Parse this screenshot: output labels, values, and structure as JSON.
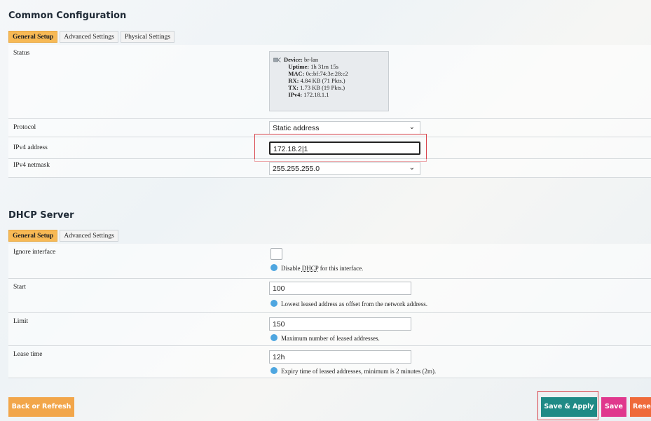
{
  "common": {
    "title": "Common Configuration",
    "tabs": [
      "General Setup",
      "Advanced Settings",
      "Physical Settings"
    ],
    "status": {
      "label": "Status",
      "device_label": "Device:",
      "device": "br-lan",
      "uptime_label": "Uptime:",
      "uptime": "1h 31m 15s",
      "mac_label": "MAC:",
      "mac": "0c:bf:74:3e:28:c2",
      "rx_label": "RX:",
      "rx": "4.84 KB (71 Pkts.)",
      "tx_label": "TX:",
      "tx": "1.73 KB (19 Pkts.)",
      "ipv4_label": "IPv4:",
      "ipv4": "172.18.1.1"
    },
    "protocol": {
      "label": "Protocol",
      "value": "Static address"
    },
    "ipv4_address": {
      "label": "IPv4 address",
      "value": "172.18.2|1"
    },
    "ipv4_netmask": {
      "label": "IPv4 netmask",
      "value": "255.255.255.0"
    }
  },
  "dhcp": {
    "title": "DHCP Server",
    "tabs": [
      "General Setup",
      "Advanced Settings"
    ],
    "ignore": {
      "label": "Ignore interface",
      "hint_pre": "Disable ",
      "hint_abbr": "DHCP",
      "hint_post": " for this interface."
    },
    "start": {
      "label": "Start",
      "value": "100",
      "hint": "Lowest leased address as offset from the network address."
    },
    "limit": {
      "label": "Limit",
      "value": "150",
      "hint": "Maximum number of leased addresses."
    },
    "lease": {
      "label": "Lease time",
      "value": "12h",
      "hint": "Expiry time of leased addresses, minimum is 2 minutes (2m)."
    }
  },
  "footer": {
    "back": "Back or Refresh",
    "save_apply": "Save & Apply",
    "save": "Save",
    "reset": "Rese"
  },
  "colors": {
    "accent": "#f7b955",
    "save_apply": "#1f8a86",
    "save": "#e0388d",
    "reset": "#ef6a3a",
    "back": "#f2a64a"
  }
}
